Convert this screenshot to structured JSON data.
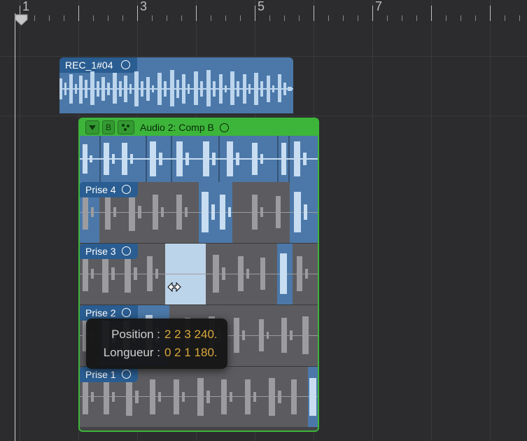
{
  "ruler": {
    "bars": [
      "1",
      "3",
      "5",
      "7"
    ]
  },
  "region": {
    "name": "REC_1#04"
  },
  "take_folder": {
    "comp_letter": "B",
    "name": "Audio 2: Comp B",
    "takes": [
      "Prise 4",
      "Prise 3",
      "Prise 2",
      "Prise 1"
    ]
  },
  "tooltip": {
    "pos_label": "Position :",
    "pos_value": "2 2 3 240.",
    "len_label": "Longueur :",
    "len_value": "0 2 1 180."
  }
}
